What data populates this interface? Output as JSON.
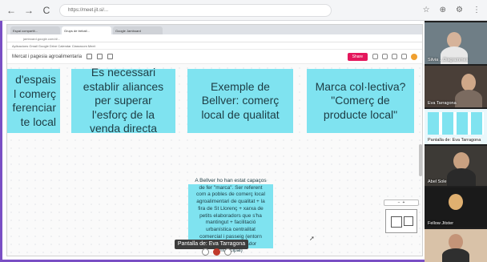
{
  "browser": {
    "back": "←",
    "forward": "→",
    "reload": "C",
    "url": "https://meet.jit.si/...",
    "icons": [
      "☆",
      "⊕",
      "⚙",
      "⋮"
    ]
  },
  "shared_screen": {
    "tabs": [
      "Espai compartit...",
      "Grups de treball...",
      "Google Jamboard"
    ],
    "address": "jamboard.google.com/d/...",
    "bookmarks": "Aplicacions   Gmail   Google   Drive   Calendar   Classroom   Meet",
    "toolbar_title": "Mercat i pagesia agroalimentaria",
    "share_label": "Share"
  },
  "notes": {
    "note1": "d'espais\nl comerç\nferenciar\nte local",
    "note2": "Es necessari establir aliances per superar l'esforç de la venda directa",
    "note3": "Exemple de Bellver: comerç local de qualitat",
    "note4": "Marca col·lectiva? \"Comerç de producte local\"",
    "note5": "A Bellver ho han estat capaços de fer \"marca\". Ser referent com a pobles de comerç local agroalimentari de qualitat + la fira de St Llorenç + xarxa de petits elaboradors que s'ha mantingut + facilitació urbanística centralitat comercial i passeig (entorn tancament escorxador municipal)"
  },
  "zoom": {
    "minus": "−",
    "plus": "+"
  },
  "presenter_label": "Pantalla de: Eva Tarragona",
  "participants": [
    {
      "name": "Silvia ...Diagrammes"
    },
    {
      "name": "Eva Tarragona"
    },
    {
      "name": "Pantalla de: Eva Tarragona"
    },
    {
      "name": "Abel Sole"
    },
    {
      "name": "Fellow Jitster"
    },
    {
      "name": ""
    }
  ],
  "colors": {
    "note_fill": "#7fe3f0",
    "frame": "#7a4fc4",
    "share_button": "#e4175c"
  }
}
